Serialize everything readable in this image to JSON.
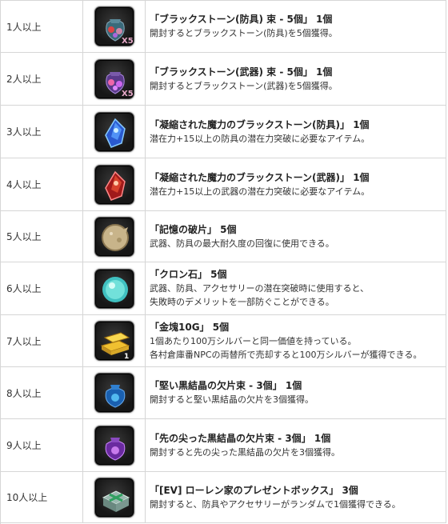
{
  "rows": [
    {
      "condition": "1人以上",
      "icon": "blackstone-armor-bundle-icon",
      "name": "「ブラックストーン(防具) 束 - 5個」 1個",
      "desc": [
        "開封するとブラックストーン(防具)を5個獲得。"
      ],
      "badge": "X5"
    },
    {
      "condition": "2人以上",
      "icon": "blackstone-weapon-bundle-icon",
      "name": "「ブラックストーン(武器) 束 - 5個」 1個",
      "desc": [
        "開封するとブラックストーン(武器)を5個獲得。"
      ],
      "badge": "X5"
    },
    {
      "condition": "3人以上",
      "icon": "concentrated-blackstone-armor-icon",
      "name": "「凝縮された魔力のブラックストーン(防具)」 1個",
      "desc": [
        "潜在力+15以上の防具の潜在力突破に必要なアイテム。"
      ]
    },
    {
      "condition": "4人以上",
      "icon": "concentrated-blackstone-weapon-icon",
      "name": "「凝縮された魔力のブラックストーン(武器)」 1個",
      "desc": [
        "潜在力+15以上の武器の潜在力突破に必要なアイテム。"
      ]
    },
    {
      "condition": "5人以上",
      "icon": "memory-fragment-icon",
      "name": "「記憶の破片」 5個",
      "desc": [
        "武器、防具の最大耐久度の回復に使用できる。"
      ]
    },
    {
      "condition": "6人以上",
      "icon": "cron-stone-icon",
      "name": "「クロン石」 5個",
      "desc": [
        "武器、防具、アクセサリーの潜在突破時に使用すると、",
        "失敗時のデメリットを一部防ぐことができる。"
      ]
    },
    {
      "condition": "7人以上",
      "icon": "gold-bar-icon",
      "name": "「金塊10G」 5個",
      "desc": [
        "1個あたり100万シルバーと同一価値を持っている。",
        "各村倉庫番NPCの両替所で売却すると100万シルバーが獲得できる。"
      ],
      "badge": "1"
    },
    {
      "condition": "8人以上",
      "icon": "hard-crystal-shard-bundle-icon",
      "name": "「堅い黒結晶の欠片束 - 3個」 1個",
      "desc": [
        "開封すると堅い黒結晶の欠片を3個獲得。"
      ]
    },
    {
      "condition": "9人以上",
      "icon": "sharp-crystal-shard-bundle-icon",
      "name": "「先の尖った黒結晶の欠片束 - 3個」 1個",
      "desc": [
        "開封すると先の尖った黒結晶の欠片を3個獲得。"
      ]
    },
    {
      "condition": "10人以上",
      "icon": "loren-present-box-icon",
      "name": "「[EV] ローレン家のプレゼントボックス」 3個",
      "desc": [
        "開封すると、防具やアクセサリーがランダムで1個獲得できる。"
      ]
    }
  ]
}
